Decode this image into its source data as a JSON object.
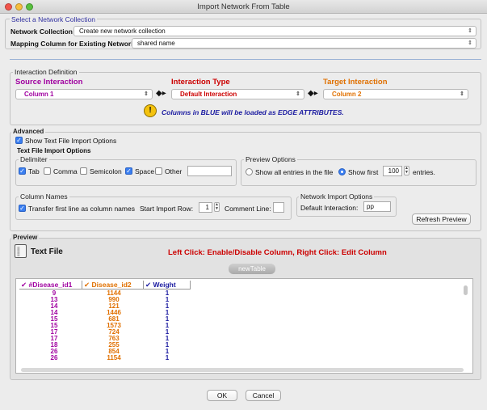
{
  "window": {
    "title": "Import Network From Table"
  },
  "network_collection": {
    "legend": "Select a Network Collection",
    "collection_label": "Network Collection",
    "collection_value": "Create new network collection",
    "mapping_label": "Mapping Column for Existing Network:",
    "mapping_value": "shared name"
  },
  "interaction": {
    "legend": "Interaction Definition",
    "source_title": "Source Interaction",
    "type_title": "Interaction Type",
    "target_title": "Target Interaction",
    "source_value": "Column 1",
    "type_value": "Default Interaction",
    "target_value": "Column 2",
    "notice": "Columns in BLUE will be loaded as EDGE ATTRIBUTES.",
    "colors": {
      "source": "#a000a0",
      "type": "#cc0000",
      "target": "#e07000",
      "notice": "#1a1aa0"
    }
  },
  "advanced": {
    "legend": "Advanced",
    "show_options_label": "Show Text File Import Options",
    "show_options_checked": true,
    "text_options_label": "Text File Import Options",
    "delimiter": {
      "legend": "Delimiter",
      "options": [
        {
          "label": "Tab",
          "checked": true
        },
        {
          "label": "Comma",
          "checked": false
        },
        {
          "label": "Semicolon",
          "checked": false
        },
        {
          "label": "Space",
          "checked": true
        },
        {
          "label": "Other",
          "checked": false
        }
      ],
      "other_value": ""
    },
    "preview_options": {
      "legend": "Preview Options",
      "show_all_label": "Show all entries in the file",
      "show_first_label": "Show first",
      "show_first_value": "100",
      "entries_label": "entries.",
      "selected": "show_first"
    },
    "column_names": {
      "legend": "Column Names",
      "transfer_label": "Transfer first line as column names",
      "transfer_checked": true,
      "start_row_label": "Start Import Row:",
      "start_row_value": "1",
      "comment_label": "Comment Line:",
      "comment_value": ""
    },
    "network_import": {
      "legend": "Network Import Options",
      "default_label": "Default Interaction:",
      "default_value": "pp"
    },
    "refresh_label": "Refresh Preview"
  },
  "preview": {
    "legend": "Preview",
    "file_label": "Text File",
    "hint": "Left Click: Enable/Disable Column, Right Click: Edit Column",
    "tab_label": "newTable",
    "columns": [
      {
        "name": "#Disease_id1",
        "color": "#a000a0"
      },
      {
        "name": "Disease_id2",
        "color": "#e07000"
      },
      {
        "name": "Weight",
        "color": "#1a1aa0"
      }
    ],
    "rows": [
      [
        "9",
        "1144",
        "1"
      ],
      [
        "13",
        "990",
        "1"
      ],
      [
        "14",
        "121",
        "1"
      ],
      [
        "14",
        "1446",
        "1"
      ],
      [
        "15",
        "681",
        "1"
      ],
      [
        "15",
        "1573",
        "1"
      ],
      [
        "17",
        "724",
        "1"
      ],
      [
        "17",
        "763",
        "1"
      ],
      [
        "18",
        "255",
        "1"
      ],
      [
        "26",
        "854",
        "1"
      ],
      [
        "26",
        "1154",
        "1"
      ]
    ]
  },
  "footer": {
    "ok_label": "OK",
    "cancel_label": "Cancel"
  }
}
